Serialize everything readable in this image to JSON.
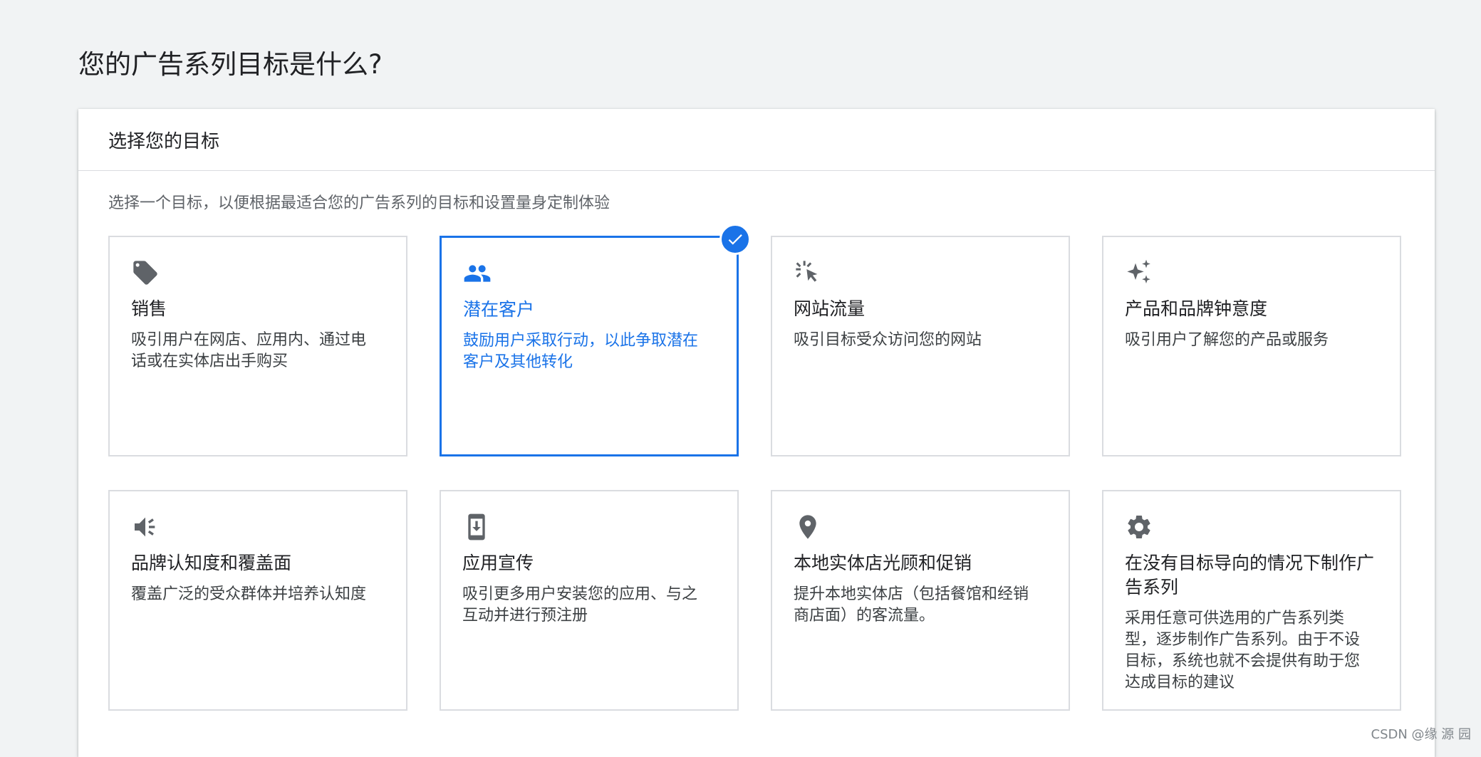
{
  "page": {
    "title": "您的广告系列目标是什么?"
  },
  "panel": {
    "header": "选择您的目标",
    "description": "选择一个目标，以便根据最适合您的广告系列的目标和设置量身定制体验"
  },
  "goals": [
    {
      "title": "销售",
      "text": "吸引用户在网店、应用内、通过电话或在实体店出手购买",
      "icon": "tag-icon",
      "selected": false
    },
    {
      "title": "潜在客户",
      "text": "鼓励用户采取行动，以此争取潜在客户及其他转化",
      "icon": "people-icon",
      "selected": true
    },
    {
      "title": "网站流量",
      "text": "吸引目标受众访问您的网站",
      "icon": "cursor-click-icon",
      "selected": false
    },
    {
      "title": "产品和品牌钟意度",
      "text": "吸引用户了解您的产品或服务",
      "icon": "sparkle-icon",
      "selected": false
    },
    {
      "title": "品牌认知度和覆盖面",
      "text": "覆盖广泛的受众群体并培养认知度",
      "icon": "megaphone-icon",
      "selected": false
    },
    {
      "title": "应用宣传",
      "text": "吸引更多用户安装您的应用、与之互动并进行预注册",
      "icon": "phone-download-icon",
      "selected": false
    },
    {
      "title": "本地实体店光顾和促销",
      "text": "提升本地实体店（包括餐馆和经销商店面）的客流量。",
      "icon": "location-pin-icon",
      "selected": false
    },
    {
      "title": "在没有目标导向的情况下制作广告系列",
      "text": "采用任意可供选用的广告系列类型，逐步制作广告系列。由于不设目标，系统也就不会提供有助于您达成目标的建议",
      "icon": "gear-icon",
      "selected": false
    }
  ],
  "watermark": "CSDN @缘 源 园",
  "colors": {
    "accent": "#1a73e8",
    "icon": "#5f6368",
    "border": "#dadce0",
    "background": "#f1f3f4"
  }
}
